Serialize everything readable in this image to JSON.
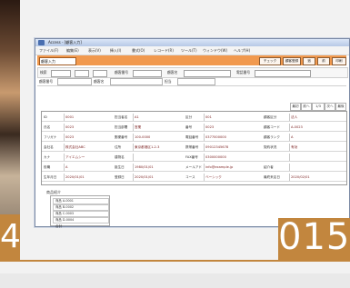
{
  "page": {
    "left_number": "4",
    "page_number": "015"
  },
  "window": {
    "title": "Access - [顧客入力]"
  },
  "menu": [
    "ファイル(F)",
    "編集(E)",
    "表示(V)",
    "挿入(I)",
    "書式(O)",
    "レコード(R)",
    "ツール(T)",
    "ウィンドウ(W)",
    "ヘルプ(H)"
  ],
  "orange_bar": {
    "field_value": "顧客入力",
    "buttons": [
      "チェック",
      "顧客登録",
      "追",
      "前",
      "印刷"
    ]
  },
  "toolbar2": {
    "labels": [
      "検索",
      "顧客番号",
      "顧客名",
      "電話番号"
    ]
  },
  "rowinfo": {
    "labels": [
      "顧客番号",
      "顧客名",
      "担当"
    ]
  },
  "pager": {
    "labels": [
      "最初",
      "前へ",
      "1/3",
      "次へ",
      "最後"
    ]
  },
  "grid": {
    "rows": [
      [
        "ID",
        "0001",
        "担当者名",
        "A1",
        "区分",
        "001",
        "顧客区分",
        "法人"
      ],
      [
        "氏名",
        "0023",
        "担当部署",
        "営業",
        "番号",
        "0023",
        "顧客コード",
        "A-0023"
      ],
      [
        "フリガナ",
        "0023",
        "郵便番号",
        "100-0000",
        "電話番号",
        "0377000000",
        "顧客ランク",
        "A"
      ],
      [
        "会社名",
        "株式会社ABC",
        "住所",
        "東京都港区1-2-3",
        "携帯番号",
        "09012345678",
        "契約状況",
        "有効"
      ],
      [
        "カナ",
        "アイエムシー",
        "建物名",
        "",
        "FAX番号",
        "0300000000",
        "",
        ""
      ],
      [
        "役職",
        "A",
        "誕生日",
        "1980/01/01",
        "メールアドレス",
        "info@example.jp",
        "紹介者",
        ""
      ],
      [
        "生年月日",
        "2020/01/01",
        "登録日",
        "2020/01/01",
        "コース",
        "ベーシック",
        "最終来店日",
        "2020/02/01"
      ]
    ]
  },
  "lower": {
    "title": "商品紹介",
    "items": [
      "商品 A-0001",
      "商品 B-0002",
      "商品 C-0003",
      "商品 D-0004"
    ],
    "footer": "合計"
  }
}
